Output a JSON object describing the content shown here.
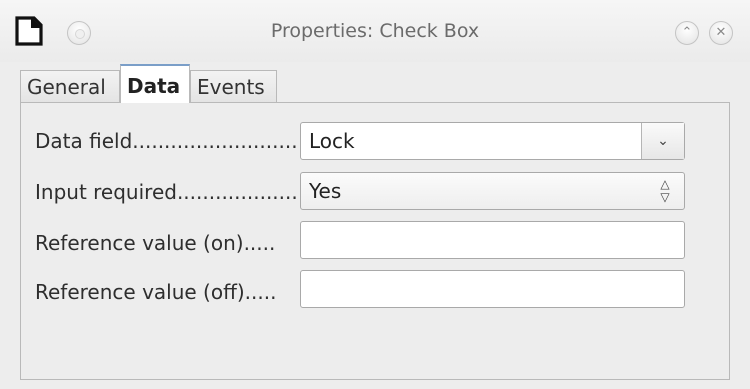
{
  "window": {
    "title": "Properties: Check Box"
  },
  "tabs": [
    {
      "label": "General"
    },
    {
      "label": "Data"
    },
    {
      "label": "Events"
    }
  ],
  "active_tab": "Data",
  "fields": {
    "data_field": {
      "label": "Data field..........................",
      "value": "Lock"
    },
    "input_required": {
      "label": "Input required...................",
      "value": "Yes"
    },
    "reference_on": {
      "label": "Reference value (on).....",
      "value": ""
    },
    "reference_off": {
      "label": "Reference value (off).....",
      "value": ""
    }
  },
  "icons": {
    "app": "libreoffice-document-icon",
    "menu": "window-menu-icon",
    "maximize": "chevron-up-icon",
    "close": "close-icon",
    "dropdown": "chevron-down-icon",
    "spin": "spin-up-down-icon"
  }
}
